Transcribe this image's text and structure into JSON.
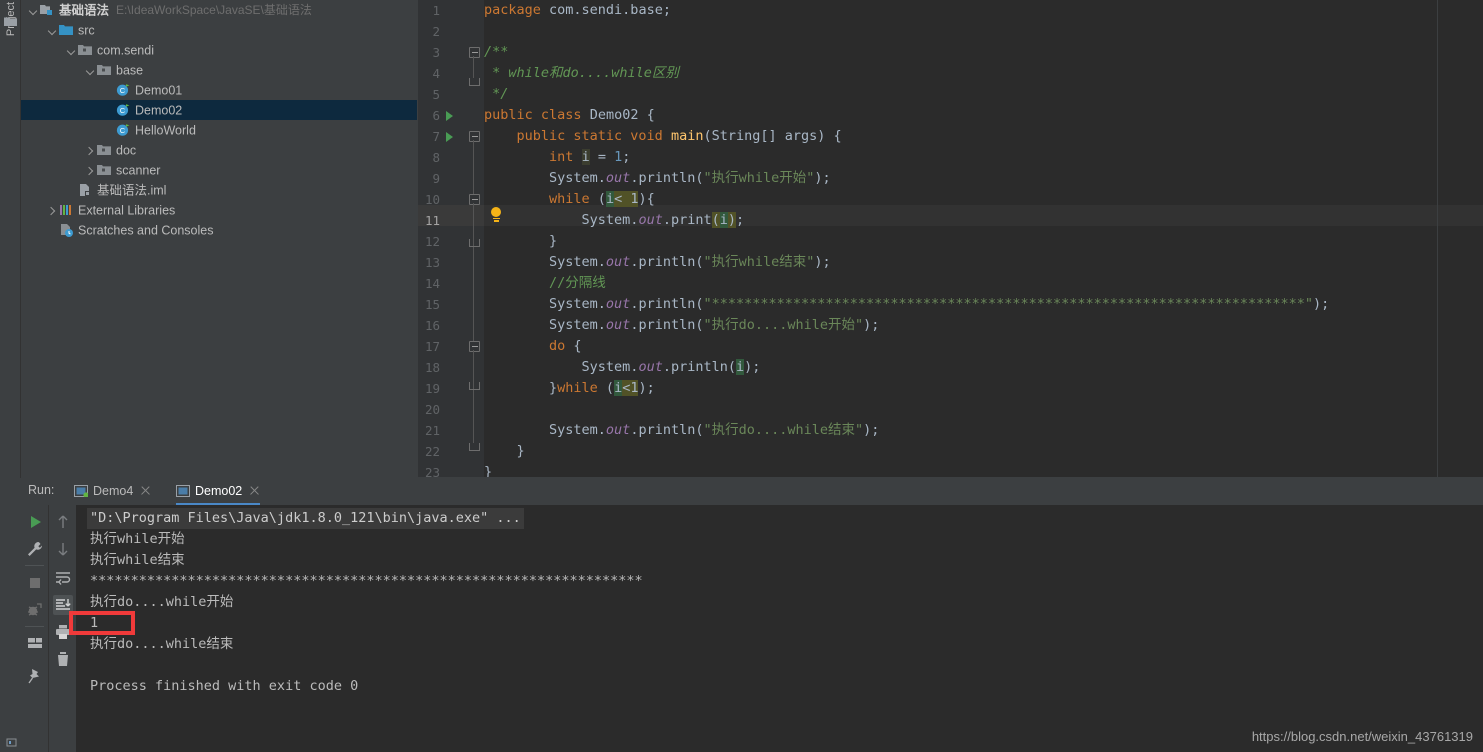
{
  "tool_strip": {
    "project_tab_label": "Project",
    "folder_icon": "folder-icon"
  },
  "project_tree": {
    "rows": [
      {
        "label": "基础语法",
        "path": "E:\\IdeaWorkSpace\\JavaSE\\基础语法",
        "icon": "module-icon",
        "indent": 1,
        "chevron": "down",
        "bold": true,
        "selected": false
      },
      {
        "label": "src",
        "path": "",
        "icon": "source-folder-icon",
        "indent": 2,
        "chevron": "down",
        "bold": false,
        "selected": false
      },
      {
        "label": "com.sendi",
        "path": "",
        "icon": "package-icon",
        "indent": 3,
        "chevron": "down",
        "bold": false,
        "selected": false
      },
      {
        "label": "base",
        "path": "",
        "icon": "package-icon",
        "indent": 4,
        "chevron": "down",
        "bold": false,
        "selected": false
      },
      {
        "label": "Demo01",
        "path": "",
        "icon": "java-class-icon",
        "indent": 5,
        "chevron": "none",
        "bold": false,
        "selected": false
      },
      {
        "label": "Demo02",
        "path": "",
        "icon": "java-class-icon",
        "indent": 5,
        "chevron": "none",
        "bold": false,
        "selected": true
      },
      {
        "label": "HelloWorld",
        "path": "",
        "icon": "java-class-icon",
        "indent": 5,
        "chevron": "none",
        "bold": false,
        "selected": false
      },
      {
        "label": "doc",
        "path": "",
        "icon": "package-icon",
        "indent": 4,
        "chevron": "right",
        "bold": false,
        "selected": false
      },
      {
        "label": "scanner",
        "path": "",
        "icon": "package-icon",
        "indent": 4,
        "chevron": "right",
        "bold": false,
        "selected": false
      },
      {
        "label": "基础语法.iml",
        "path": "",
        "icon": "iml-file-icon",
        "indent": 3,
        "chevron": "none",
        "bold": false,
        "selected": false
      },
      {
        "label": "External Libraries",
        "path": "",
        "icon": "libraries-icon",
        "indent": 2,
        "chevron": "right",
        "bold": false,
        "selected": false
      },
      {
        "label": "Scratches and Consoles",
        "path": "",
        "icon": "scratches-icon",
        "indent": 2,
        "chevron": "none",
        "bold": false,
        "selected": false
      }
    ]
  },
  "editor": {
    "current_line": 11,
    "line_numbers": [
      1,
      2,
      3,
      4,
      5,
      6,
      7,
      8,
      9,
      10,
      11,
      12,
      13,
      14,
      15,
      16,
      17,
      18,
      19,
      20,
      21,
      22,
      23
    ],
    "run_arrow_lines": [
      6,
      7
    ],
    "bulb_line": 11,
    "lines": [
      {
        "n": 1,
        "html": "<span class=\"kw\">package</span> com.sendi.base;"
      },
      {
        "n": 2,
        "html": ""
      },
      {
        "n": 3,
        "html": "<span class=\"cmt\">/**</span>"
      },
      {
        "n": 4,
        "html": "<span class=\"cmt\"> * while和do....while区别</span>"
      },
      {
        "n": 5,
        "html": "<span class=\"cmt\"> */</span>"
      },
      {
        "n": 6,
        "html": "<span class=\"kw\">public class</span> <span class=\"cls\">Demo02</span> {"
      },
      {
        "n": 7,
        "html": "    <span class=\"kw\">public static void</span> <span class=\"mth\">main</span>(String[] args) {"
      },
      {
        "n": 8,
        "html": "        <span class=\"kw\">int</span> <span class=\"idhl\">i</span> = <span class=\"num\">1</span>;"
      },
      {
        "n": 9,
        "html": "        System.<span class=\"fld\">out</span>.println(<span class=\"str\">\"执行while开始\"</span>);"
      },
      {
        "n": 10,
        "html": "        <span class=\"kw\">while</span> (<span class=\"hl\">i</span><span class=\"hl2\">&lt; 1</span>){"
      },
      {
        "n": 11,
        "html": "            System.<span class=\"fld\">out</span>.print<span class=\"hl2\">(</span><span class=\"hl\">i</span><span class=\"hl2\">)</span>;"
      },
      {
        "n": 12,
        "html": "        }"
      },
      {
        "n": 13,
        "html": "        System.<span class=\"fld\">out</span>.println(<span class=\"str\">\"执行while结束\"</span>);"
      },
      {
        "n": 14,
        "html": "        <span class=\"lcmt\">//分隔线</span>"
      },
      {
        "n": 15,
        "html": "        System.<span class=\"fld\">out</span>.println(<span class=\"str\">\"*************************************************************************\"</span>);"
      },
      {
        "n": 16,
        "html": "        System.<span class=\"fld\">out</span>.println(<span class=\"str\">\"执行do....while开始\"</span>);"
      },
      {
        "n": 17,
        "html": "        <span class=\"kw\">do</span> {"
      },
      {
        "n": 18,
        "html": "            System.<span class=\"fld\">out</span>.println(<span class=\"hl\">i</span>);"
      },
      {
        "n": 19,
        "html": "        }<span class=\"kw\">while</span> (<span class=\"hl\">i</span><span class=\"hl2\">&lt;1</span>);"
      },
      {
        "n": 20,
        "html": ""
      },
      {
        "n": 21,
        "html": "        System.<span class=\"fld\">out</span>.println(<span class=\"str\">\"执行do....while结束\"</span>);"
      },
      {
        "n": 22,
        "html": "    }"
      },
      {
        "n": 23,
        "html": "}"
      }
    ]
  },
  "run_panel": {
    "run_label": "Run:",
    "tabs": [
      {
        "label": "Demo4",
        "active": false,
        "running_dot": true,
        "icon": "console-tab-icon",
        "close_icon": "close-icon"
      },
      {
        "label": "Demo02",
        "active": true,
        "running_dot": false,
        "icon": "console-tab-icon",
        "close_icon": "close-icon"
      }
    ],
    "toolbar_left": [
      {
        "name": "rerun-button",
        "icon": "run-icon"
      },
      {
        "name": "settings-button",
        "icon": "wrench-icon"
      },
      {
        "name": "stop-button",
        "icon": "stop-icon"
      },
      {
        "name": "resume-button",
        "icon": "debug-rerun-icon"
      },
      {
        "name": "layout-button",
        "icon": "layout-icon"
      },
      {
        "name": "pin-button",
        "icon": "pin-icon"
      }
    ],
    "toolbar_right": [
      {
        "name": "up-button",
        "icon": "arrow-up-icon"
      },
      {
        "name": "down-button",
        "icon": "arrow-down-icon"
      },
      {
        "name": "soft-wrap-button",
        "icon": "soft-wrap-icon"
      },
      {
        "name": "scroll-end-button",
        "icon": "scroll-to-end-icon"
      },
      {
        "name": "print-button",
        "icon": "print-icon"
      },
      {
        "name": "clear-all-button",
        "icon": "trash-icon"
      }
    ],
    "console_output": [
      {
        "text": "\"D:\\Program Files\\Java\\jdk1.8.0_121\\bin\\java.exe\" ...",
        "cmd": true
      },
      {
        "text": "执行while开始",
        "cmd": false
      },
      {
        "text": "执行while结束",
        "cmd": false
      },
      {
        "text": "********************************************************************",
        "cmd": false
      },
      {
        "text": "执行do....while开始",
        "cmd": false
      },
      {
        "text": "1",
        "cmd": false
      },
      {
        "text": "执行do....while结束",
        "cmd": false
      },
      {
        "text": "",
        "cmd": false
      },
      {
        "text": "Process finished with exit code 0",
        "cmd": false
      }
    ],
    "highlight_box": {
      "name": "output-highlight-box",
      "color": "#f03a3a"
    }
  },
  "watermark": {
    "text": "https://blog.csdn.net/weixin_43761319"
  },
  "colors": {
    "panel_bg": "#3c3f41",
    "editor_bg": "#2b2b2b",
    "gutter_bg": "#313335",
    "selection_bg": "#0d293e",
    "accent_blue": "#4a88c7",
    "keyword": "#cc7832",
    "string": "#6a8759",
    "comment": "#629755",
    "number": "#6897bb",
    "field": "#9876aa",
    "method": "#ffc66d",
    "default_text": "#a9b7c6"
  }
}
